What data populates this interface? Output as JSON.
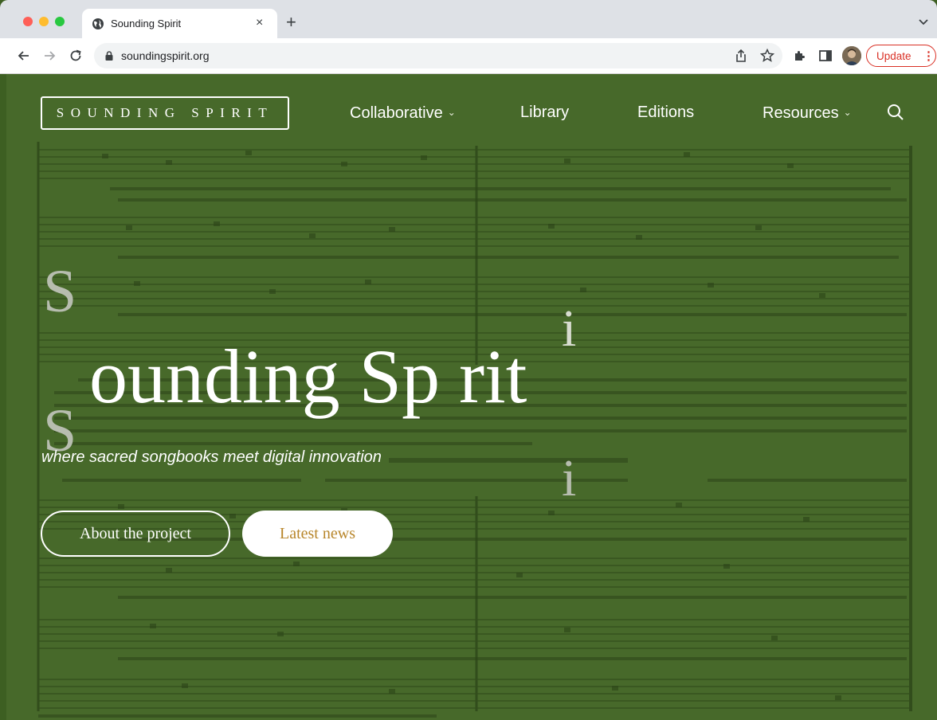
{
  "browser": {
    "tab_title": "Sounding Spirit",
    "tab_close": "×",
    "new_tab": "+",
    "url": "soundingspirit.org",
    "update_label": "Update",
    "update_menu": "⋮"
  },
  "site": {
    "logo": "SOUNDING SPIRIT",
    "nav": [
      {
        "label": "Collaborative",
        "dropdown": "⌄"
      },
      {
        "label": "Library"
      },
      {
        "label": "Editions"
      },
      {
        "label": "Resources",
        "dropdown": "⌄"
      }
    ]
  },
  "hero": {
    "letter_s_top": "S",
    "letter_s_bottom": "S",
    "letter_i_top": "i",
    "letter_i_bottom": "i",
    "title": "ounding Sp rit",
    "tagline": "where sacred songbooks meet digital innovation",
    "buttons": {
      "about": "About the project",
      "news": "Latest news"
    }
  },
  "colors": {
    "page_overlay": "#47692a",
    "news_button_text": "#b8862b",
    "update_red": "#d93025"
  }
}
